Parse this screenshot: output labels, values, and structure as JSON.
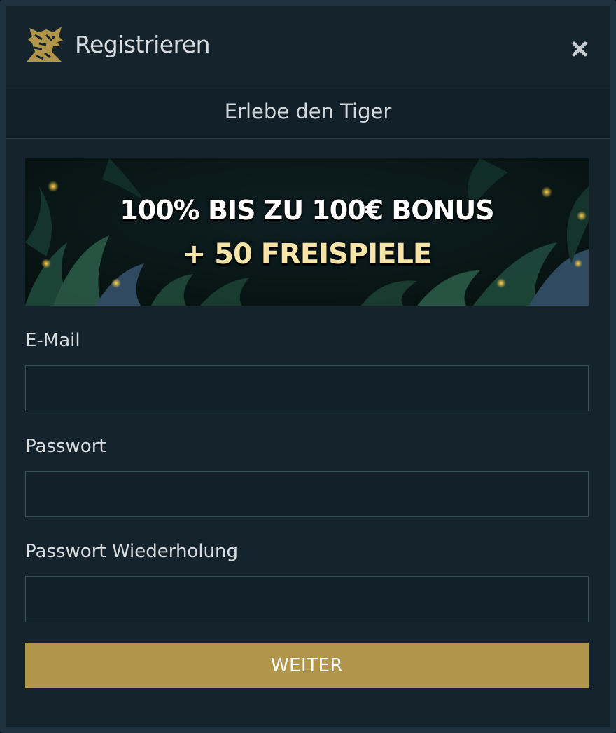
{
  "header": {
    "logo_icon": "tiger-head-icon",
    "title": "Registrieren",
    "close_icon": "close-icon"
  },
  "subheader": {
    "title": "Erlebe den Tiger"
  },
  "banner": {
    "line1": "100% BIS ZU 100€ BONUS",
    "line2": "+ 50 FREISPIELE"
  },
  "form": {
    "email_label": "E-Mail",
    "email_value": "",
    "password_label": "Passwort",
    "password_value": "",
    "password_repeat_label": "Passwort Wiederholung",
    "password_repeat_value": "",
    "submit_label": "WEITER"
  },
  "colors": {
    "modal_background": "#14232c",
    "modal_border": "#1e313c",
    "accent_gold": "#b0954b",
    "text": "#d9dde0",
    "input_border": "#3a5259"
  }
}
